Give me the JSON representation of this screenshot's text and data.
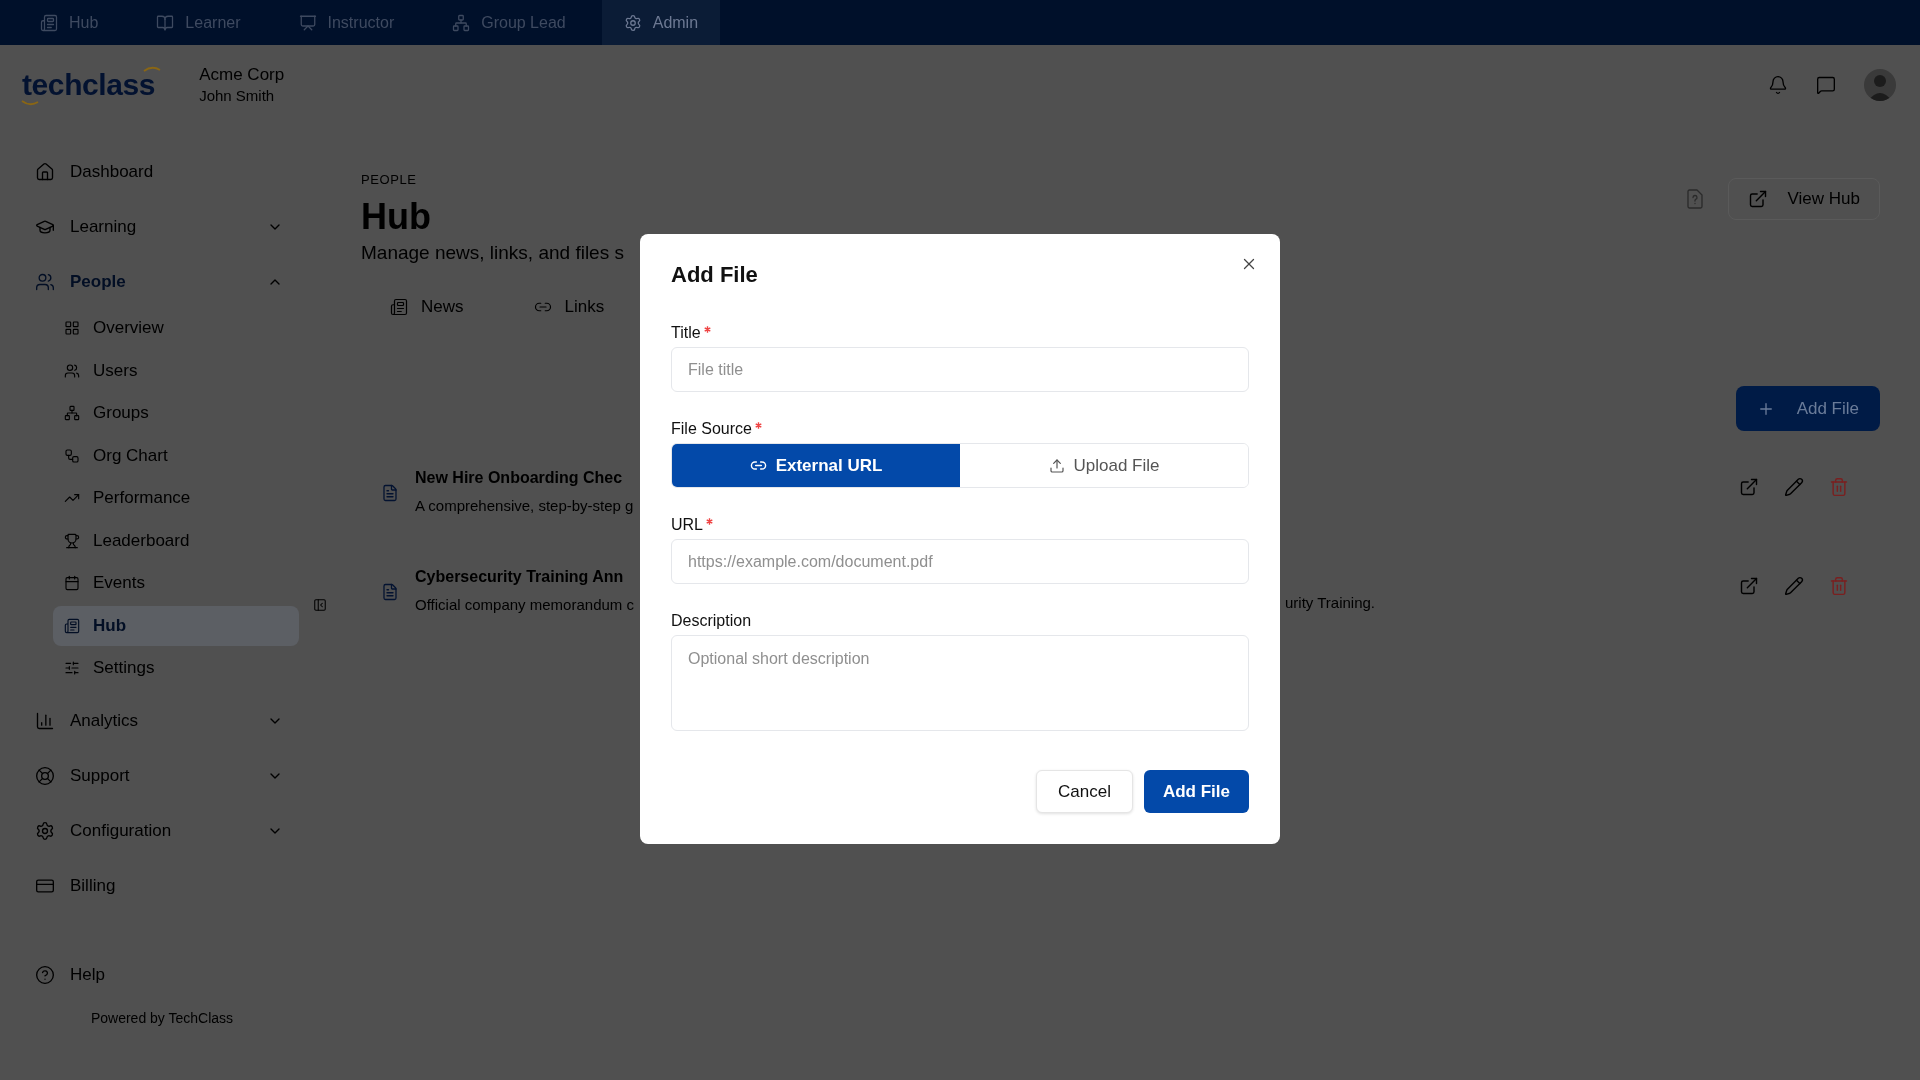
{
  "top_nav": [
    {
      "label": "Hub",
      "selected": false
    },
    {
      "label": "Learner",
      "selected": false
    },
    {
      "label": "Instructor",
      "selected": false
    },
    {
      "label": "Group Lead",
      "selected": false
    },
    {
      "label": "Admin",
      "selected": true
    }
  ],
  "header": {
    "logo": "techclass",
    "organization": "Acme Corp",
    "user": "John Smith"
  },
  "sidebar": {
    "items": [
      {
        "kind": "link",
        "label": "Dashboard",
        "selected": false
      },
      {
        "kind": "group",
        "label": "Learning",
        "selected": false,
        "expanded": false
      },
      {
        "kind": "group",
        "label": "People",
        "selected": true,
        "expanded": true,
        "children": [
          {
            "label": "Overview",
            "selected": false
          },
          {
            "label": "Users",
            "selected": false
          },
          {
            "label": "Groups",
            "selected": false
          },
          {
            "label": "Org Chart",
            "selected": false
          },
          {
            "label": "Performance",
            "selected": false
          },
          {
            "label": "Leaderboard",
            "selected": false
          },
          {
            "label": "Events",
            "selected": false
          },
          {
            "label": "Hub",
            "selected": true
          },
          {
            "label": "Settings",
            "selected": false
          }
        ]
      },
      {
        "kind": "group",
        "label": "Analytics",
        "selected": false,
        "expanded": false
      },
      {
        "kind": "group",
        "label": "Support",
        "selected": false,
        "expanded": false
      },
      {
        "kind": "group",
        "label": "Configuration",
        "selected": false,
        "expanded": false
      },
      {
        "kind": "link",
        "label": "Billing",
        "selected": false
      }
    ],
    "help": "Help",
    "footer": "Powered by TechClass"
  },
  "page": {
    "breadcrumb": "PEOPLE",
    "title": "Hub",
    "subtitle": "Manage news, links, and files s",
    "view_button": "View Hub",
    "tabs": [
      {
        "label": "News",
        "selected": false
      },
      {
        "label": "Links",
        "selected": false
      }
    ],
    "add_button": "Add File",
    "files": [
      {
        "title": "New Hire Onboarding Chec",
        "description": "A comprehensive, step-by-step g"
      },
      {
        "title": "Cybersecurity Training Ann",
        "description": "Official company memorandum c",
        "description_end": "urity Training."
      }
    ]
  },
  "modal": {
    "title": "Add File",
    "fields": [
      {
        "kind": "text",
        "label": "Title",
        "required": true,
        "placeholder": "File title"
      },
      {
        "kind": "source",
        "label": "File Source",
        "required": true,
        "options": [
          {
            "label": "External URL",
            "selected": true
          },
          {
            "label": "Upload File",
            "selected": false
          }
        ]
      },
      {
        "kind": "text",
        "label": "URL",
        "required": true,
        "placeholder": "https://example.com/document.pdf"
      },
      {
        "kind": "textarea",
        "label": "Description",
        "required": false,
        "placeholder": "Optional short description"
      }
    ],
    "buttons": [
      {
        "kind": "secondary",
        "label": "Cancel"
      },
      {
        "kind": "primary",
        "label": "Add File"
      }
    ]
  }
}
